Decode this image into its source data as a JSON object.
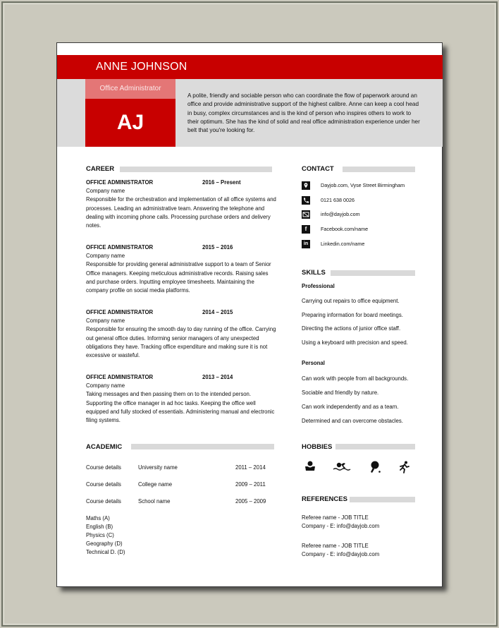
{
  "header": {
    "name": "ANNE JOHNSON",
    "role": "Office Administrator",
    "initials": "AJ",
    "summary": "A polite, friendly and sociable person who can coordinate the flow of paperwork around an office and provide administrative support of the highest calibre. Anne can keep a cool head in busy, complex circumstances and is the kind of person who inspires others to work to their optimum. She has the kind of solid and real office administration experience under her belt that you're looking for."
  },
  "colors": {
    "brand_red": "#c80000",
    "light_red": "#e47676",
    "band_gray": "#dbdbdb",
    "bar_gray": "#d9d9d9"
  },
  "career": {
    "heading": "CAREER",
    "jobs": [
      {
        "title": "OFFICE ADMINISTRATOR",
        "dates": "2016 – Present",
        "company": "Company name",
        "description": "Responsible for the orchestration and implementation of all office systems and processes. Leading an administrative team. Answering the telephone and dealing with incoming phone calls. Processing purchase orders and delivery notes."
      },
      {
        "title": "OFFICE ADMINISTRATOR",
        "dates": "2015 – 2016",
        "company": "Company name",
        "description": "Responsible for providing general administrative support to a team of Senior Office managers. Keeping meticulous administrative records. Raising sales and purchase orders. Inputting employee timesheets. Maintaining the company profile on social media platforms."
      },
      {
        "title": "OFFICE ADMINISTRATOR",
        "dates": "2014 – 2015",
        "company": "Company name",
        "description": "Responsible for ensuring the smooth day to day running of the office. Carrying out general office duties. Informing senior managers of any unexpected obligations they have. Tracking office expenditure and making sure it is not excessive or wasteful."
      },
      {
        "title": "OFFICE ADMINISTRATOR",
        "dates": "2013 – 2014",
        "company": "Company name",
        "description": "Taking messages and then passing them on to the intended person. Supporting the office manager in ad hoc tasks. Keeping the office well equipped and fully stocked of essentials. Administering manual and electronic filing systems."
      }
    ]
  },
  "academic": {
    "heading": "ACADEMIC",
    "rows": [
      {
        "course": "Course details",
        "institution": "University name",
        "dates": "2011 – 2014"
      },
      {
        "course": "Course details",
        "institution": "College name",
        "dates": "2009 – 2011"
      },
      {
        "course": "Course details",
        "institution": "School name",
        "dates": "2005 – 2009"
      }
    ],
    "subjects": [
      "Maths (A)",
      "English (B)",
      "Physics (C)",
      "Geography (D)",
      "Technical D. (D)"
    ]
  },
  "contact": {
    "heading": "CONTACT",
    "items": [
      {
        "icon": "location-pin-icon",
        "text": "Dayjob.com, Vyse Street Birmingham"
      },
      {
        "icon": "phone-icon",
        "text": "0121 638 0026"
      },
      {
        "icon": "email-icon",
        "text": "info@dayjob.com"
      },
      {
        "icon": "facebook-icon",
        "text": "Facebook.com/name"
      },
      {
        "icon": "linkedin-icon",
        "text": "Linkedin.com/name"
      }
    ]
  },
  "skills": {
    "heading": "SKILLS",
    "professional_label": "Professional",
    "professional": [
      "Carrying out repairs to office equipment.",
      "Preparing information for board meetings.",
      "Directing the actions of junior office staff.",
      "Using a keyboard with precision and speed."
    ],
    "personal_label": "Personal",
    "personal": [
      "Can work with people from all backgrounds.",
      "Sociable and friendly by nature.",
      "Can work independently and as a team.",
      "Determined and can overcome obstacles."
    ]
  },
  "hobbies": {
    "heading": "HOBBIES",
    "items": [
      "reading-icon",
      "swimming-icon",
      "table-tennis-icon",
      "running-icon"
    ]
  },
  "references": {
    "heading": "REFERENCES",
    "items": [
      {
        "line1": "Referee name - JOB TITLE",
        "line2": "Company - E: info@dayjob.com"
      },
      {
        "line1": "Referee name - JOB TITLE",
        "line2": "Company - E: info@dayjob.com"
      }
    ]
  }
}
